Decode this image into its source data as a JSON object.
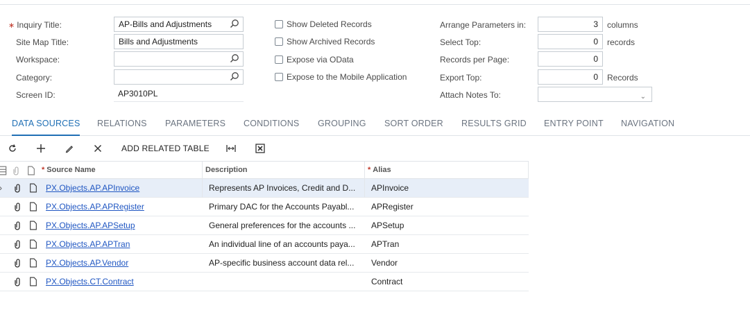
{
  "form": {
    "inquiry_title_label": "Inquiry Title:",
    "inquiry_title_value": "AP-Bills and Adjustments",
    "site_map_title_label": "Site Map Title:",
    "site_map_title_value": "Bills and Adjustments",
    "workspace_label": "Workspace:",
    "workspace_value": "",
    "category_label": "Category:",
    "category_value": "",
    "screen_id_label": "Screen ID:",
    "screen_id_value": "AP3010PL",
    "show_deleted_label": "Show Deleted Records",
    "show_archived_label": "Show Archived Records",
    "expose_odata_label": "Expose via OData",
    "expose_mobile_label": "Expose to the Mobile Application",
    "arrange_label": "Arrange Parameters in:",
    "arrange_value": "3",
    "arrange_unit": "columns",
    "select_top_label": "Select Top:",
    "select_top_value": "0",
    "select_top_unit": "records",
    "records_per_page_label": "Records per Page:",
    "records_per_page_value": "0",
    "export_top_label": "Export Top:",
    "export_top_value": "0",
    "export_top_unit": "Records",
    "attach_notes_label": "Attach Notes To:",
    "attach_notes_value": ""
  },
  "tabs": [
    "DATA SOURCES",
    "RELATIONS",
    "PARAMETERS",
    "CONDITIONS",
    "GROUPING",
    "SORT ORDER",
    "RESULTS GRID",
    "ENTRY POINT",
    "NAVIGATION"
  ],
  "toolbar": {
    "add_related_label": "ADD RELATED TABLE"
  },
  "grid": {
    "columns": {
      "source_name": "Source Name",
      "description": "Description",
      "alias": "Alias"
    },
    "rows": [
      {
        "source": "PX.Objects.AP.APInvoice",
        "description": "Represents AP Invoices, Credit and D...",
        "alias": "APInvoice"
      },
      {
        "source": "PX.Objects.AP.APRegister",
        "description": "Primary DAC for the Accounts Payabl...",
        "alias": "APRegister"
      },
      {
        "source": "PX.Objects.AP.APSetup",
        "description": "General preferences for the accounts ...",
        "alias": "APSetup"
      },
      {
        "source": "PX.Objects.AP.APTran",
        "description": "An individual line of an accounts paya...",
        "alias": "APTran"
      },
      {
        "source": "PX.Objects.AP.Vendor",
        "description": "AP-specific business account data rel...",
        "alias": "Vendor"
      },
      {
        "source": "PX.Objects.CT.Contract",
        "description": "",
        "alias": "Contract"
      }
    ]
  }
}
